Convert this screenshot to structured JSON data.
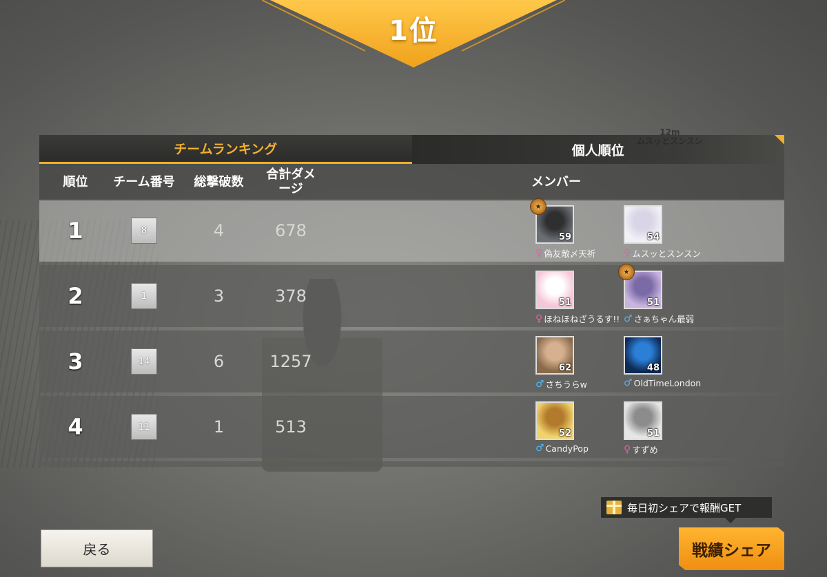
{
  "banner": {
    "rank": "1位"
  },
  "tabs": [
    {
      "label": "チームランキング",
      "active": true
    },
    {
      "label": "個人順位",
      "active": false
    }
  ],
  "ghost_overlay": {
    "distance": "12m",
    "name": "ムスッとスンスン"
  },
  "table": {
    "headers": {
      "rank": "順位",
      "team": "チーム番号",
      "kills": "総撃破数",
      "damage": "合計ダメージ",
      "members": "メンバー"
    },
    "rows": [
      {
        "rank": "1",
        "team": "8",
        "kills": "4",
        "damage": "678",
        "members": [
          {
            "name": "偽友敵〆天祈",
            "level": "59",
            "gender": "female",
            "badge": true
          },
          {
            "name": "ムスッとスンスン",
            "level": "54",
            "gender": "female",
            "badge": false
          }
        ]
      },
      {
        "rank": "2",
        "team": "1",
        "kills": "3",
        "damage": "378",
        "members": [
          {
            "name": "ほねほねざうるす!!",
            "level": "51",
            "gender": "female",
            "badge": false
          },
          {
            "name": "さぁちゃん最弱",
            "level": "51",
            "gender": "male",
            "badge": true
          }
        ]
      },
      {
        "rank": "3",
        "team": "14",
        "kills": "6",
        "damage": "1257",
        "members": [
          {
            "name": "さちうらw",
            "level": "62",
            "gender": "male",
            "badge": false
          },
          {
            "name": "OldTimeLondon",
            "level": "48",
            "gender": "male",
            "badge": false
          }
        ]
      },
      {
        "rank": "4",
        "team": "11",
        "kills": "1",
        "damage": "513",
        "members": [
          {
            "name": "CandyPop",
            "level": "52",
            "gender": "male",
            "badge": false
          },
          {
            "name": "すずめ",
            "level": "51",
            "gender": "female",
            "badge": false
          }
        ]
      }
    ]
  },
  "gender_symbols": {
    "female": "♀",
    "male": "♂"
  },
  "footer": {
    "back_label": "戻る",
    "share_label": "戦績シェア",
    "reward_tip": "毎日初シェアで報酬GET"
  },
  "colors": {
    "accent": "#f0b02e",
    "share_button": "#f5a01c",
    "female": "#f05aa8",
    "male": "#4fb6f0"
  }
}
